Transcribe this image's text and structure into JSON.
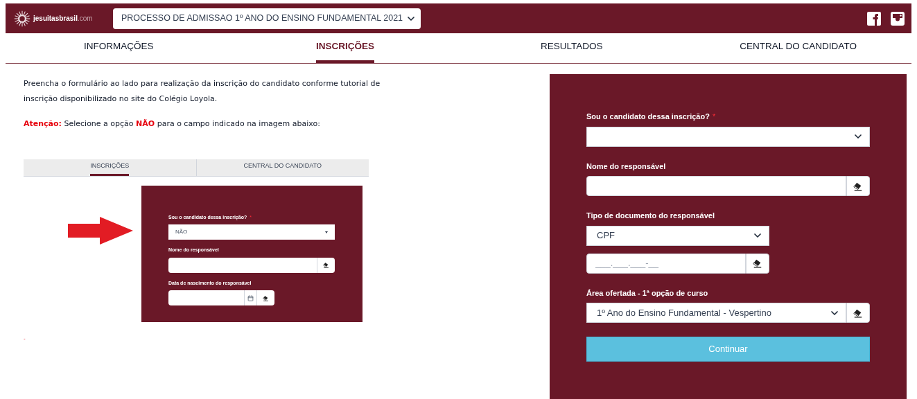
{
  "header": {
    "brand": {
      "name": "jesuitasbrasil",
      "suffix": ".com"
    },
    "process_select": {
      "value": "PROCESSO DE ADMISSAO 1º ANO DO ENSINO FUNDAMENTAL 2021"
    }
  },
  "nav_tabs": [
    {
      "label": "INFORMAÇÕES",
      "selected": false
    },
    {
      "label": "INSCRIÇÕES",
      "selected": true
    },
    {
      "label": "RESULTADOS",
      "selected": false
    },
    {
      "label": "CENTRAL DO CANDIDATO",
      "selected": false
    }
  ],
  "intro": {
    "paragraph": "Preencha o formulário ao lado para realização da inscrição do candidato conforme tutorial de inscrição disponibilizado no site do Colégio Loyola.",
    "notice": "**Atenção:** Selecione a opção **NÃO** para o campo indicado na imagem abaixo:"
  },
  "example_image": {
    "tabs": [
      {
        "label": "INSCRIÇÕES",
        "selected": true
      },
      {
        "label": "CENTRAL DO CANDIDATO",
        "selected": false
      }
    ],
    "fields": [
      {
        "kind": "select",
        "label": "Sou o candidato dessa inscrição?",
        "required_mark": "*",
        "value": "NÃO"
      },
      {
        "kind": "text",
        "label": "Nome do responsável"
      },
      {
        "kind": "date",
        "label": "Data de nascimento do responsável"
      }
    ]
  },
  "footnote": "-",
  "form": {
    "fields": [
      {
        "kind": "select",
        "label": "Sou o candidato dessa inscrição?",
        "required_mark": "*",
        "clearable": false,
        "compact": false
      },
      {
        "kind": "text",
        "label": "Nome do responsável",
        "clearable": true,
        "compact": false
      },
      {
        "kind": "select",
        "label": "Tipo de documento do responsável",
        "clearable": false,
        "compact": true,
        "value": "CPF"
      },
      {
        "kind": "text",
        "placeholder": "___.___.___-__",
        "clearable": true,
        "compact": true
      },
      {
        "kind": "select",
        "label": "Área ofertada - 1ª opção de curso",
        "clearable": true,
        "compact": false,
        "value": "1º Ano do Ensino Fundamental - Vespertino"
      }
    ],
    "submit": "Continuar"
  }
}
